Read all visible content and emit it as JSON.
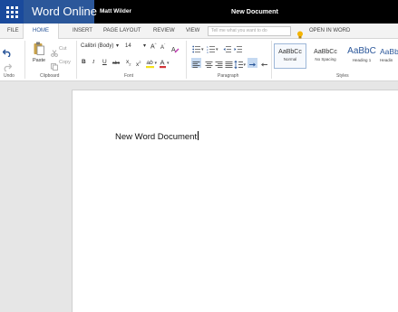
{
  "app": {
    "name": "Word Online",
    "user": "Matt Wilder",
    "document_title": "New Document"
  },
  "tabs": [
    {
      "label": "FILE"
    },
    {
      "label": "HOME"
    },
    {
      "label": "INSERT"
    },
    {
      "label": "PAGE LAYOUT"
    },
    {
      "label": "REVIEW"
    },
    {
      "label": "VIEW"
    }
  ],
  "active_tab": "HOME",
  "tell_me": {
    "placeholder": "Tell me what you want to do"
  },
  "open_in_word": "OPEN IN WORD",
  "ribbon": {
    "undo": {
      "label": "Undo"
    },
    "clipboard": {
      "label": "Clipboard",
      "paste": "Paste",
      "cut": "Cut",
      "copy": "Copy"
    },
    "font": {
      "label": "Font",
      "name": "Calibri (Body)",
      "size": "14"
    },
    "paragraph": {
      "label": "Paragraph"
    },
    "styles": {
      "label": "Styles",
      "items": [
        {
          "sample": "AaBbCc",
          "name": "Normal",
          "selected": true
        },
        {
          "sample": "AaBbCc",
          "name": "No Spacing",
          "selected": false
        },
        {
          "sample": "AaBbC",
          "name": "Heading 1",
          "selected": false
        },
        {
          "sample": "AaBb",
          "name": "Headin",
          "selected": false
        }
      ]
    }
  },
  "document": {
    "body_text": "New Word Document"
  },
  "colors": {
    "brand_blue": "#2b579a",
    "title_bar": "#000000",
    "highlight_yellow": "#f4e11a",
    "font_red": "#d13438",
    "tell_me_bulb": "#f4b400"
  }
}
